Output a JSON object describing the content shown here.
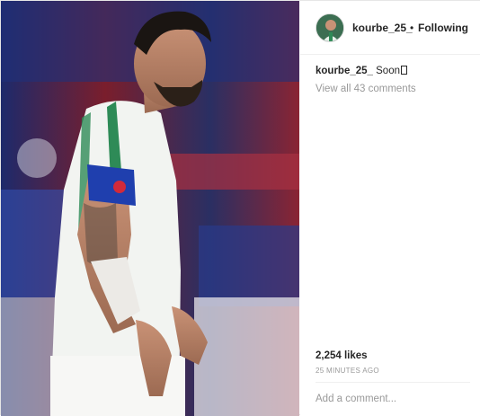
{
  "post": {
    "username": "kourbe_25_",
    "dot": "•",
    "follow_state": "Following",
    "caption_user": "kourbe_25_",
    "caption_text": "Soon",
    "view_all_comments": "View all 43 comments",
    "likes": "2,254 likes",
    "timestamp": "25 MINUTES AGO",
    "add_comment_placeholder": "Add a comment...",
    "photo_subject": "football player in white-green kit with captain armband",
    "avatar_subject": "profile picture"
  },
  "colors": {
    "text": "#262626",
    "muted": "#999999",
    "border": "#efefef",
    "kit_green": "#2e8b57",
    "armband_blue": "#1f3fae"
  }
}
